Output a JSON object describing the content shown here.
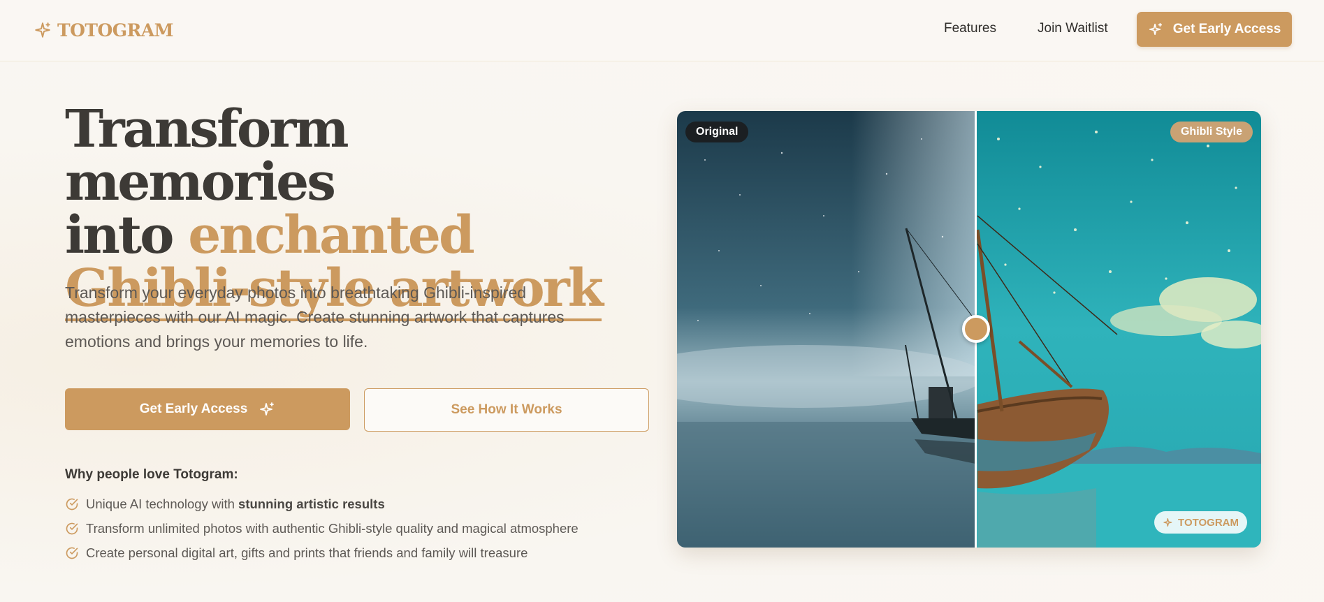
{
  "header": {
    "logo_text": "TOTOGRAM",
    "nav": {
      "features": "Features",
      "join_waitlist": "Join Waitlist"
    },
    "cta": "Get Early Access"
  },
  "hero": {
    "headline_line1": "Transform memories",
    "headline_into": "into ",
    "headline_accent": "enchanted",
    "headline_line3": "Ghibli-style artwork",
    "subtitle": "Transform your everyday photos into breathtaking Ghibli-inspired masterpieces with our AI magic. Create stunning artwork that captures emotions and brings your memories to life.",
    "primary_button": "Get Early Access",
    "secondary_button": "See How It Works",
    "why_title": "Why people love Totogram:",
    "benefits": [
      {
        "text": "Unique AI technology with ",
        "bold": "stunning artistic results"
      },
      {
        "text": "Transform unlimited photos with authentic Ghibli-style quality and magical atmosphere",
        "bold": ""
      },
      {
        "text": "Create personal digital art, gifts and prints that friends and family will treasure",
        "bold": ""
      }
    ]
  },
  "comparison": {
    "left_label": "Original",
    "right_label": "Ghibli Style",
    "watermark": "TOTOGRAM"
  },
  "colors": {
    "accent": "#cc9a5f",
    "background": "#faf7f3",
    "heading": "#3d3a36",
    "body_text": "#5d5955"
  },
  "icons": [
    "sparkle-icon",
    "check-circle-icon"
  ]
}
